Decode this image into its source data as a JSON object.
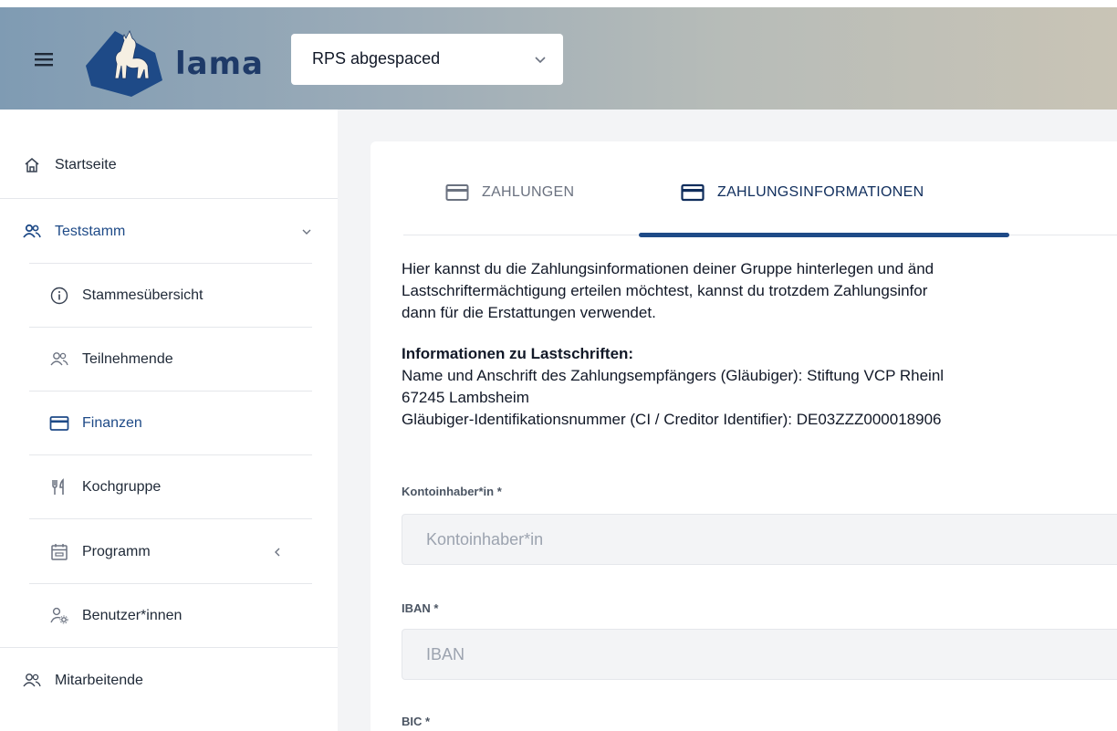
{
  "header": {
    "logo_text": "lama",
    "group_select": {
      "value": "RPS abgespaced"
    }
  },
  "sidebar": {
    "items": [
      {
        "label": "Startseite",
        "icon": "home-icon"
      },
      {
        "label": "Teststamm",
        "icon": "users-icon",
        "active": true
      },
      {
        "label": "Stammesübersicht",
        "icon": "info-icon"
      },
      {
        "label": "Teilnehmende",
        "icon": "users-icon"
      },
      {
        "label": "Finanzen",
        "icon": "credit-card-icon",
        "active": true
      },
      {
        "label": "Kochgruppe",
        "icon": "cutlery-icon"
      },
      {
        "label": "Programm",
        "icon": "calendar-icon"
      },
      {
        "label": "Benutzer*innen",
        "icon": "user-settings-icon"
      },
      {
        "label": "Mitarbeitende",
        "icon": "users-icon"
      }
    ]
  },
  "main": {
    "tabs": [
      {
        "label": "ZAHLUNGEN",
        "icon": "credit-card-icon"
      },
      {
        "label": "ZAHLUNGSINFORMATIONEN",
        "icon": "credit-card-icon",
        "active": true
      }
    ],
    "intro_lines": [
      "Hier kannst du die Zahlungsinformationen deiner Gruppe hinterlegen und änd",
      "Lastschriftermächtigung erteilen möchtest, kannst du trotzdem Zahlungsinfor",
      "dann für die Erstattungen verwendet."
    ],
    "info_heading": "Informationen zu Lastschriften:",
    "info_lines": [
      "Name und Anschrift des Zahlungsempfängers (Gläubiger): Stiftung VCP Rheinl",
      "67245 Lambsheim",
      "Gläubiger-Identifikationsnummer (CI / Creditor Identifier): DE03ZZZ000018906"
    ],
    "fields": [
      {
        "label": "Kontoinhaber*in *",
        "placeholder": "Kontoinhaber*in"
      },
      {
        "label": "IBAN *",
        "placeholder": "IBAN"
      },
      {
        "label": "BIC *"
      }
    ]
  },
  "colors": {
    "accent": "#1e4a87",
    "header_gradient_start": "#7f9bb3",
    "header_gradient_end": "#c9c4b6"
  }
}
